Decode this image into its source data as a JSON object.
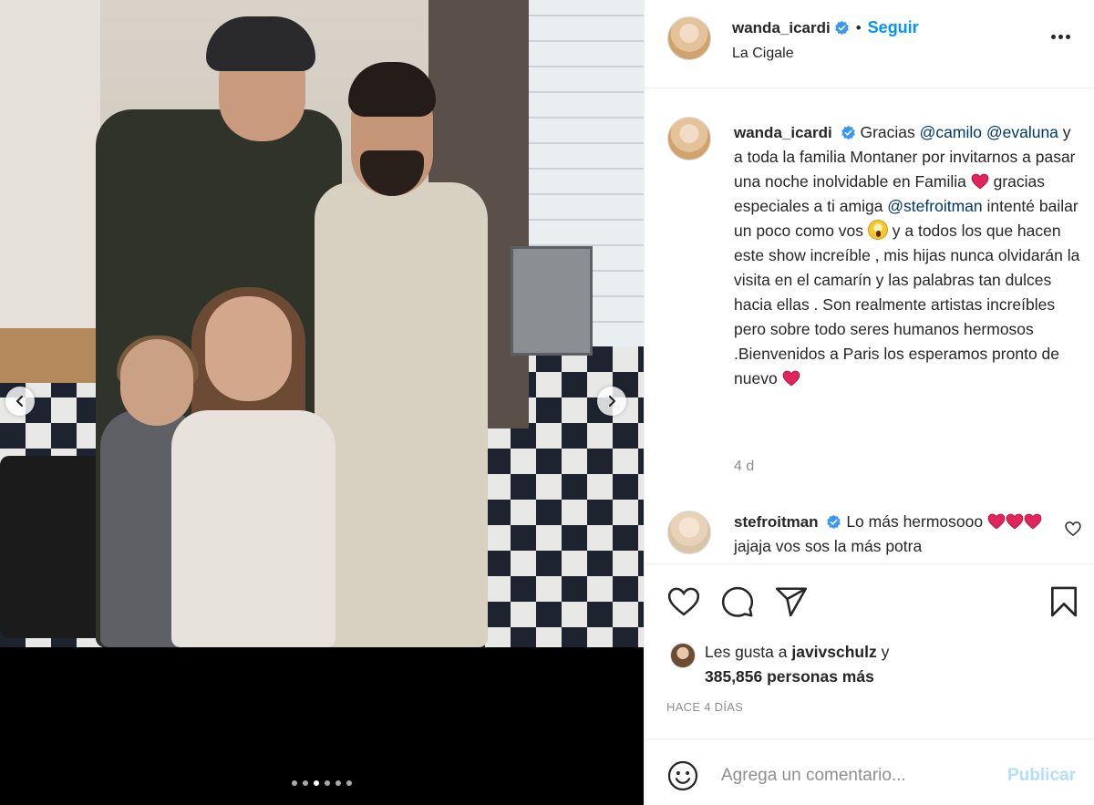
{
  "post": {
    "carousel": {
      "total": 6,
      "active_index": 2
    }
  },
  "header": {
    "username": "wanda_icardi",
    "separator": "•",
    "follow_label": "Seguir",
    "location": "La Cigale"
  },
  "caption": {
    "username": "wanda_icardi",
    "p1": "Gracias ",
    "m1": "@camilo",
    "p2": " ",
    "m2": "@evaluna",
    "p3": " y a toda la familia Montaner por invitarnos a pasar una noche inolvidable en Familia ",
    "p4": " gracias especiales a ti amiga ",
    "m3": "@stefroitman",
    "p5": " intenté bailar un poco como vos ",
    "p6": " y a todos los que hacen este show increíble , mis hijas nunca olvidarán la visita en el camarín y las palabras tan dulces hacia ellas . Son realmente artistas increíbles pero sobre todo seres humanos hermosos .Bienvenidos a Paris los esperamos pronto de nuevo ",
    "time": "4 d"
  },
  "comment1": {
    "username": "stefroitman",
    "text_a": " Lo más hermosooo ",
    "text_b": " jajaja vos sos la más potra"
  },
  "likes": {
    "prefix": "Les gusta a ",
    "user": "javivschulz",
    "mid": " y",
    "count": "385,856 personas más"
  },
  "date_label": "HACE 4 DÍAS",
  "add_comment": {
    "placeholder": "Agrega un comentario...",
    "publish_label": "Publicar"
  },
  "icons": [
    "chevron-left-icon",
    "chevron-right-icon",
    "verified-icon",
    "more-icon",
    "heart-icon",
    "comment-icon",
    "share-icon",
    "bookmark-icon",
    "emoji-icon"
  ],
  "colors": {
    "link": "#0095f6",
    "mention": "#00376b",
    "verified": "#3897f0",
    "heart": "#e0245e",
    "muted": "#8e8e8e"
  }
}
